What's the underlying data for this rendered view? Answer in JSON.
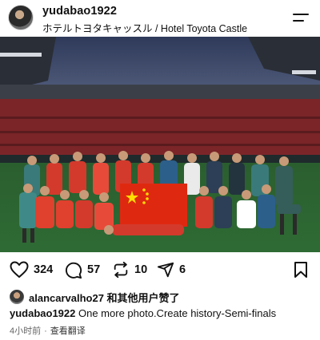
{
  "post": {
    "username": "yudabao1922",
    "location": "ホテルトヨタキャッスル /  Hotel Toyota Castle"
  },
  "photo": {
    "scoreboard_text": "",
    "icons": [
      "menu-icon",
      "heart-icon",
      "comment-icon",
      "repost-icon",
      "share-icon",
      "bookmark-icon"
    ]
  },
  "actions": {
    "likes": "324",
    "comments": "57",
    "reposts": "10",
    "shares": "6"
  },
  "liked_by": {
    "text": "alancarvalho27 和其他用户赞了"
  },
  "caption": {
    "username": "yudabao1922",
    "text": "One more photo.Create history-Semi-finals"
  },
  "meta": {
    "time": "4小时前",
    "separator": "·",
    "translate": "查看翻译"
  },
  "colors": {
    "sky": "#3a4566",
    "pitch": "#2f6a33",
    "seat": "#8a2a2c",
    "team_kit": "#d33a2c",
    "staff_kit": "#2c5f8a",
    "flag": "#de2910",
    "flag_star": "#ffde00"
  }
}
